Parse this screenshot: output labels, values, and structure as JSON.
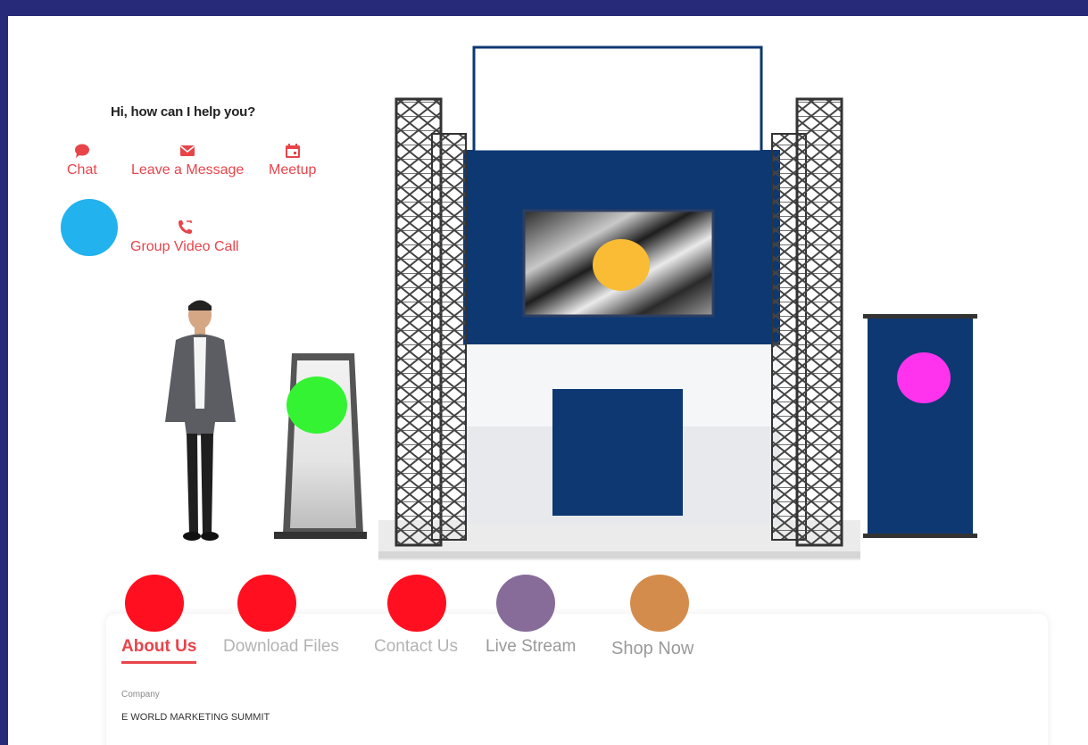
{
  "help": {
    "title": "Hi, how can I help you?",
    "options": [
      {
        "label": "Chat",
        "icon": "chat-bubble-icon"
      },
      {
        "label": "Leave a Message",
        "icon": "envelope-icon"
      },
      {
        "label": "Meetup",
        "icon": "calendar-icon"
      },
      {
        "label": "Group Video Call",
        "icon": "phone-icon"
      }
    ]
  },
  "tabs": [
    {
      "label": "About Us",
      "active": true
    },
    {
      "label": "Download Files",
      "active": false
    },
    {
      "label": "Contact Us",
      "active": false
    },
    {
      "label": "Live Stream",
      "active": false
    },
    {
      "label": "Shop Now",
      "active": false
    }
  ],
  "company": {
    "label": "Company",
    "value": "E WORLD MARKETING SUMMIT"
  },
  "colors": {
    "accent": "#e8444a",
    "frame_border": "#262a78",
    "booth_navy": "#0d3872",
    "hotspot_blue": "#22b2ee",
    "hotspot_orange": "#f9bc34",
    "hotspot_green": "#33f333",
    "hotspot_magenta": "#ff33ee",
    "hotspot_red": "#ff0f1f",
    "hotspot_purple": "#876c99",
    "hotspot_tan": "#d48c4d"
  }
}
